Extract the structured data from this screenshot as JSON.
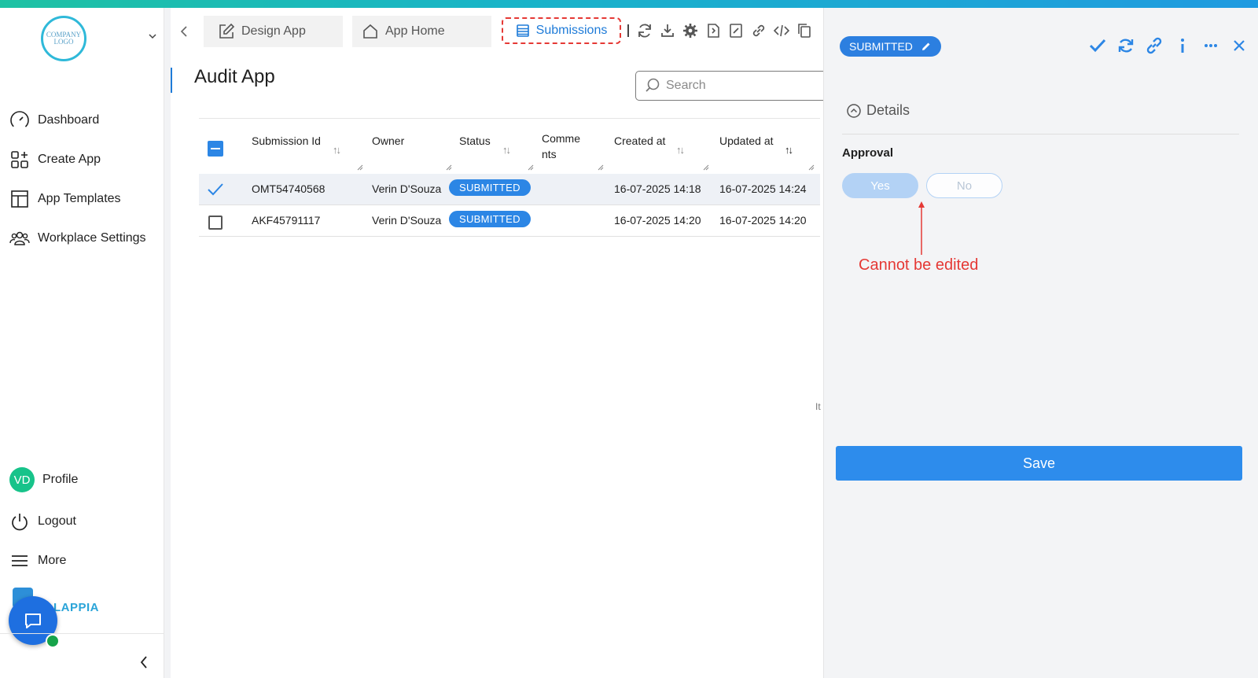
{
  "sidebar": {
    "logo_text": "COMPANY LOGO",
    "items": [
      {
        "label": "Dashboard",
        "icon": "dashboard-gauge-icon"
      },
      {
        "label": "Create App",
        "icon": "create-app-icon"
      },
      {
        "label": "App Templates",
        "icon": "templates-icon"
      },
      {
        "label": "Workplace Settings",
        "icon": "people-icon"
      }
    ],
    "profile": {
      "initials": "VD",
      "label": "Profile"
    },
    "logout_label": "Logout",
    "more_label": "More",
    "brand": "LAPPIA"
  },
  "tabs": {
    "design": "Design App",
    "home": "App Home",
    "submissions": "Submissions"
  },
  "page": {
    "title": "Audit App",
    "search_placeholder": "Search",
    "edge_text": "It"
  },
  "table": {
    "columns": [
      "Submission Id",
      "Owner",
      "Status",
      "Comme nts",
      "Created at",
      "Updated at"
    ],
    "rows": [
      {
        "id": "OMT54740568",
        "owner": "Verin D'Souza",
        "status": "SUBMITTED",
        "comments": "",
        "created": "16-07-2025 14:18",
        "updated": "16-07-2025 14:24",
        "selected": true
      },
      {
        "id": "AKF45791117",
        "owner": "Verin D'Souza",
        "status": "SUBMITTED",
        "comments": "",
        "created": "16-07-2025 14:20",
        "updated": "16-07-2025 14:20",
        "selected": false
      }
    ]
  },
  "panel": {
    "status": "SUBMITTED",
    "section": "Details",
    "field_label": "Approval",
    "options": [
      "Yes",
      "No"
    ],
    "selected_option": "Yes",
    "annotation": "Cannot be edited",
    "save_label": "Save"
  },
  "colors": {
    "accent": "#2c86e5",
    "annotation": "#e53935",
    "avatar": "#17c38a"
  }
}
